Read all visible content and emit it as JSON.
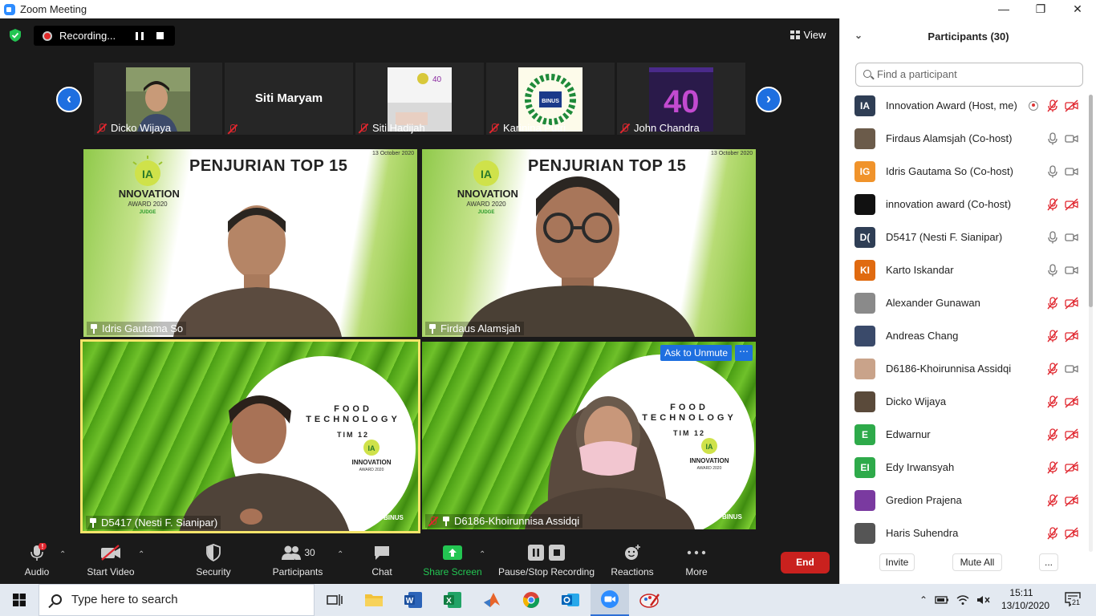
{
  "window": {
    "title": "Zoom Meeting",
    "minimize": "—",
    "maximize": "❐",
    "close": "✕"
  },
  "topbar": {
    "recording_label": "Recording...",
    "view_label": "View"
  },
  "thumbnails": [
    {
      "name": "Dicko Wijaya",
      "has_photo": true
    },
    {
      "name": "Siti Maryam",
      "has_photo": false
    },
    {
      "name": "Siti Hadijah",
      "has_photo": true
    },
    {
      "name": "Karinina Putri",
      "has_photo": true
    },
    {
      "name": "John Chandra",
      "has_photo": true
    }
  ],
  "tiles": {
    "t1": {
      "name": "Idris Gautama So",
      "slide_title": "PENJURIAN TOP 15",
      "date": "13 October 2020",
      "logo_line1": "INNOVATION",
      "logo_line2": "AWARD 2020",
      "logo_line3": "JUDGE"
    },
    "t2": {
      "name": "Firdaus Alamsjah",
      "slide_title": "PENJURIAN TOP 15",
      "date": "13 October 2020",
      "logo_line1": "INNOVATION",
      "logo_line2": "AWARD 2020",
      "logo_line3": "JUDGE"
    },
    "t3": {
      "name": "D5417 (Nesti F. Sianipar)",
      "food1": "FOOD",
      "food2": "TECHNOLOGY",
      "team": "TIM 12",
      "logo_line1": "INNOVATION",
      "logo_line2": "AWARD 2020",
      "brand": "BINUS"
    },
    "t4": {
      "name": "D6186-Khoirunnisa Assidqi",
      "food1": "FOOD",
      "food2": "TECHNOLOGY",
      "team": "TIM 12",
      "logo_line1": "INNOVATION",
      "logo_line2": "AWARD 2020",
      "brand": "BINUS",
      "ask_label": "Ask to Unmute",
      "more_label": "⋯"
    }
  },
  "toolbar": {
    "audio": "Audio",
    "start_video": "Start Video",
    "security": "Security",
    "participants": "Participants",
    "participants_count": "30",
    "chat": "Chat",
    "share_screen": "Share Screen",
    "pause_stop": "Pause/Stop Recording",
    "reactions": "Reactions",
    "more": "More",
    "end": "End"
  },
  "panel": {
    "title": "Participants (30)",
    "search_placeholder": "Find a participant",
    "participants": [
      {
        "initials": "IA",
        "name": "Innovation Award (Host, me)",
        "color": "#2f3e55",
        "mic": "muted",
        "video": "off"
      },
      {
        "initials": "",
        "name": "Firdaus Alamsjah (Co-host)",
        "color": "#6b5b4a",
        "mic": "on",
        "video": "on"
      },
      {
        "initials": "IG",
        "name": "Idris Gautama So (Co-host)",
        "color": "#f0932b",
        "mic": "on",
        "video": "on"
      },
      {
        "initials": "",
        "name": "innovation award (Co-host)",
        "color": "#111111",
        "mic": "muted",
        "video": "off"
      },
      {
        "initials": "D(",
        "name": "D5417 (Nesti F. Sianipar)",
        "color": "#2f3e55",
        "mic": "on",
        "video": "on"
      },
      {
        "initials": "KI",
        "name": "Karto Iskandar",
        "color": "#e06a10",
        "mic": "on",
        "video": "on"
      },
      {
        "initials": "",
        "name": "Alexander Gunawan",
        "color": "#8a8a8a",
        "mic": "muted",
        "video": "off"
      },
      {
        "initials": "",
        "name": "Andreas Chang",
        "color": "#3a4a6a",
        "mic": "muted",
        "video": "off"
      },
      {
        "initials": "",
        "name": "D6186-Khoirunnisa Assidqi",
        "color": "#c9a38a",
        "mic": "muted",
        "video": "on"
      },
      {
        "initials": "",
        "name": "Dicko Wijaya",
        "color": "#5a4a3a",
        "mic": "muted",
        "video": "off"
      },
      {
        "initials": "E",
        "name": "Edwarnur",
        "color": "#2eaa4a",
        "mic": "muted",
        "video": "off"
      },
      {
        "initials": "EI",
        "name": "Edy Irwansyah",
        "color": "#2eaa4a",
        "mic": "muted",
        "video": "off"
      },
      {
        "initials": "",
        "name": "Gredion Prajena",
        "color": "#7a3aa0",
        "mic": "muted",
        "video": "off"
      },
      {
        "initials": "",
        "name": "Haris Suhendra",
        "color": "#555555",
        "mic": "muted",
        "video": "off"
      }
    ],
    "invite": "Invite",
    "mute_all": "Mute All",
    "more": "..."
  },
  "taskbar": {
    "search_placeholder": "Type here to search",
    "time": "15:11",
    "date": "13/10/2020",
    "notifications": "21"
  },
  "colors": {
    "zoom_blue": "#1e6fe0",
    "end_red": "#c9211e",
    "share_green": "#23c552",
    "muted_red": "#e0262e"
  }
}
